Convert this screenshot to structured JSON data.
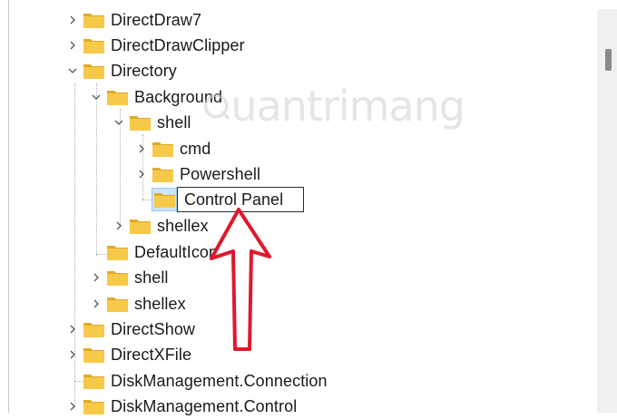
{
  "tree": {
    "items": [
      {
        "label": "DirectDraw7"
      },
      {
        "label": "DirectDrawClipper"
      },
      {
        "label": "Directory"
      },
      {
        "label": "Background"
      },
      {
        "label": "shell"
      },
      {
        "label": "cmd"
      },
      {
        "label": "Powershell"
      },
      {
        "label": "Control Panel"
      },
      {
        "label": "shellex"
      },
      {
        "label": "DefaultIcon"
      },
      {
        "label": "shell"
      },
      {
        "label": "shellex"
      },
      {
        "label": "DirectShow"
      },
      {
        "label": "DirectXFile"
      },
      {
        "label": "DiskManagement.Connection"
      },
      {
        "label": "DiskManagement.Control"
      }
    ]
  },
  "watermark": {
    "text": "uantrimang"
  },
  "colors": {
    "folder": "#f7c948",
    "folder_dark": "#e0a92a",
    "arrow": "#e0182d"
  }
}
